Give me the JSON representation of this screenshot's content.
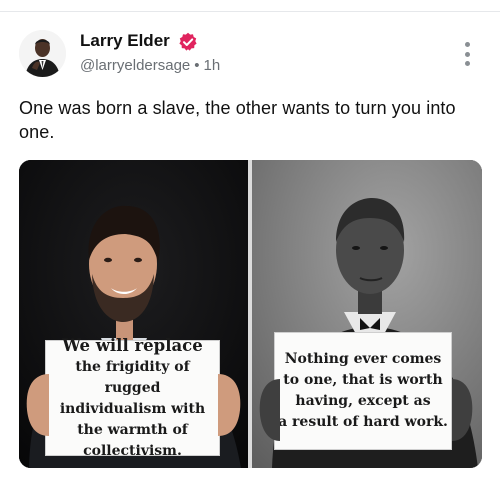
{
  "post": {
    "author_name": "Larry Elder",
    "handle": "@larryeldersage",
    "separator": "•",
    "time": "1h",
    "text": "One was born a slave, the other wants to turn you into one."
  },
  "colors": {
    "verified_badge": "#e0245e",
    "handle_gray": "#6a6f74"
  },
  "icons": {
    "verified": "verified-badge-icon",
    "more": "more-options-icon"
  },
  "media": {
    "left_sign_lines": [
      "We will replace",
      "the frigidity of rugged",
      "individualism with",
      "the warmth of",
      "collectivism."
    ],
    "right_sign_lines": [
      "Nothing ever comes",
      "to one, that is worth",
      "having, except as",
      "a result of hard work."
    ]
  }
}
